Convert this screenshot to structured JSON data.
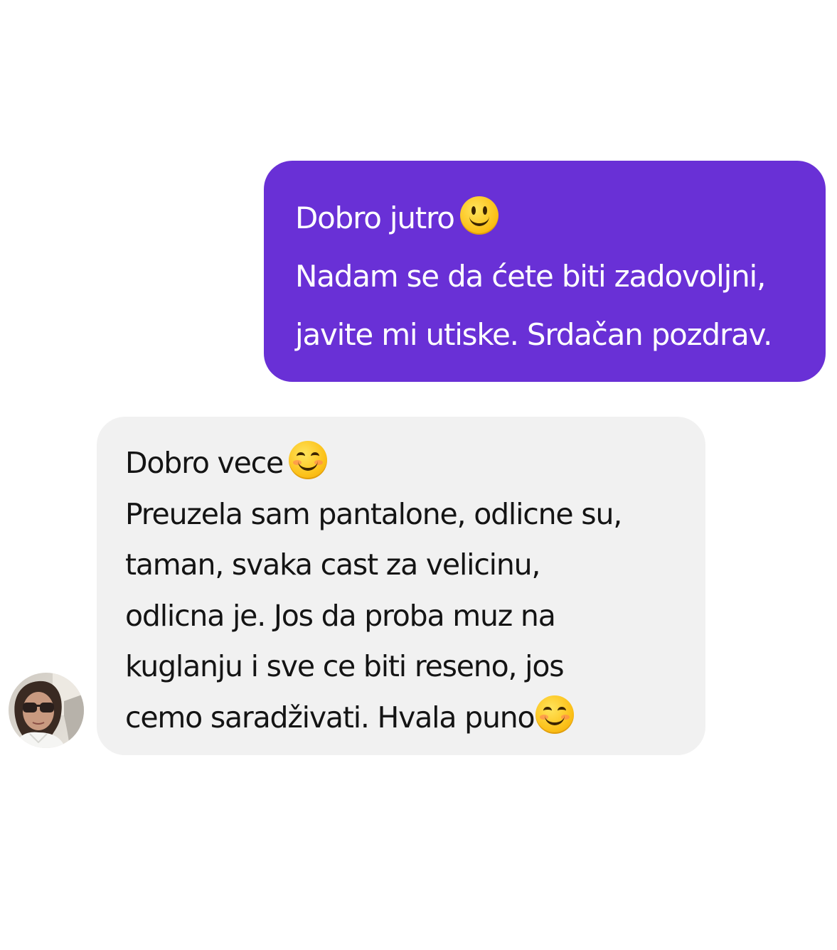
{
  "conversation": {
    "outgoing_message": {
      "lines": [
        "Dobro jutro",
        "Nadam se da ćete biti zadovoljni,",
        "javite mi utiske. Srdačan pozdrav."
      ],
      "emoji": "slightly-smiling-face",
      "bubble_color": "#6930d6",
      "text_color": "#ffffff"
    },
    "incoming_message": {
      "lines": [
        "Dobro vece",
        "Preuzela sam pantalone, odlicne su,",
        "taman, svaka cast za velicinu,",
        "odlicna je. Jos da proba muz na",
        "kuglanju i sve ce biti reseno, jos",
        "cemo saradživati. Hvala puno"
      ],
      "emoji": "smiling-face-with-smiling-eyes",
      "bubble_color": "#f1f1f1",
      "text_color": "#141414"
    },
    "sender_avatar": {
      "icon": "profile-photo-avatar"
    }
  }
}
